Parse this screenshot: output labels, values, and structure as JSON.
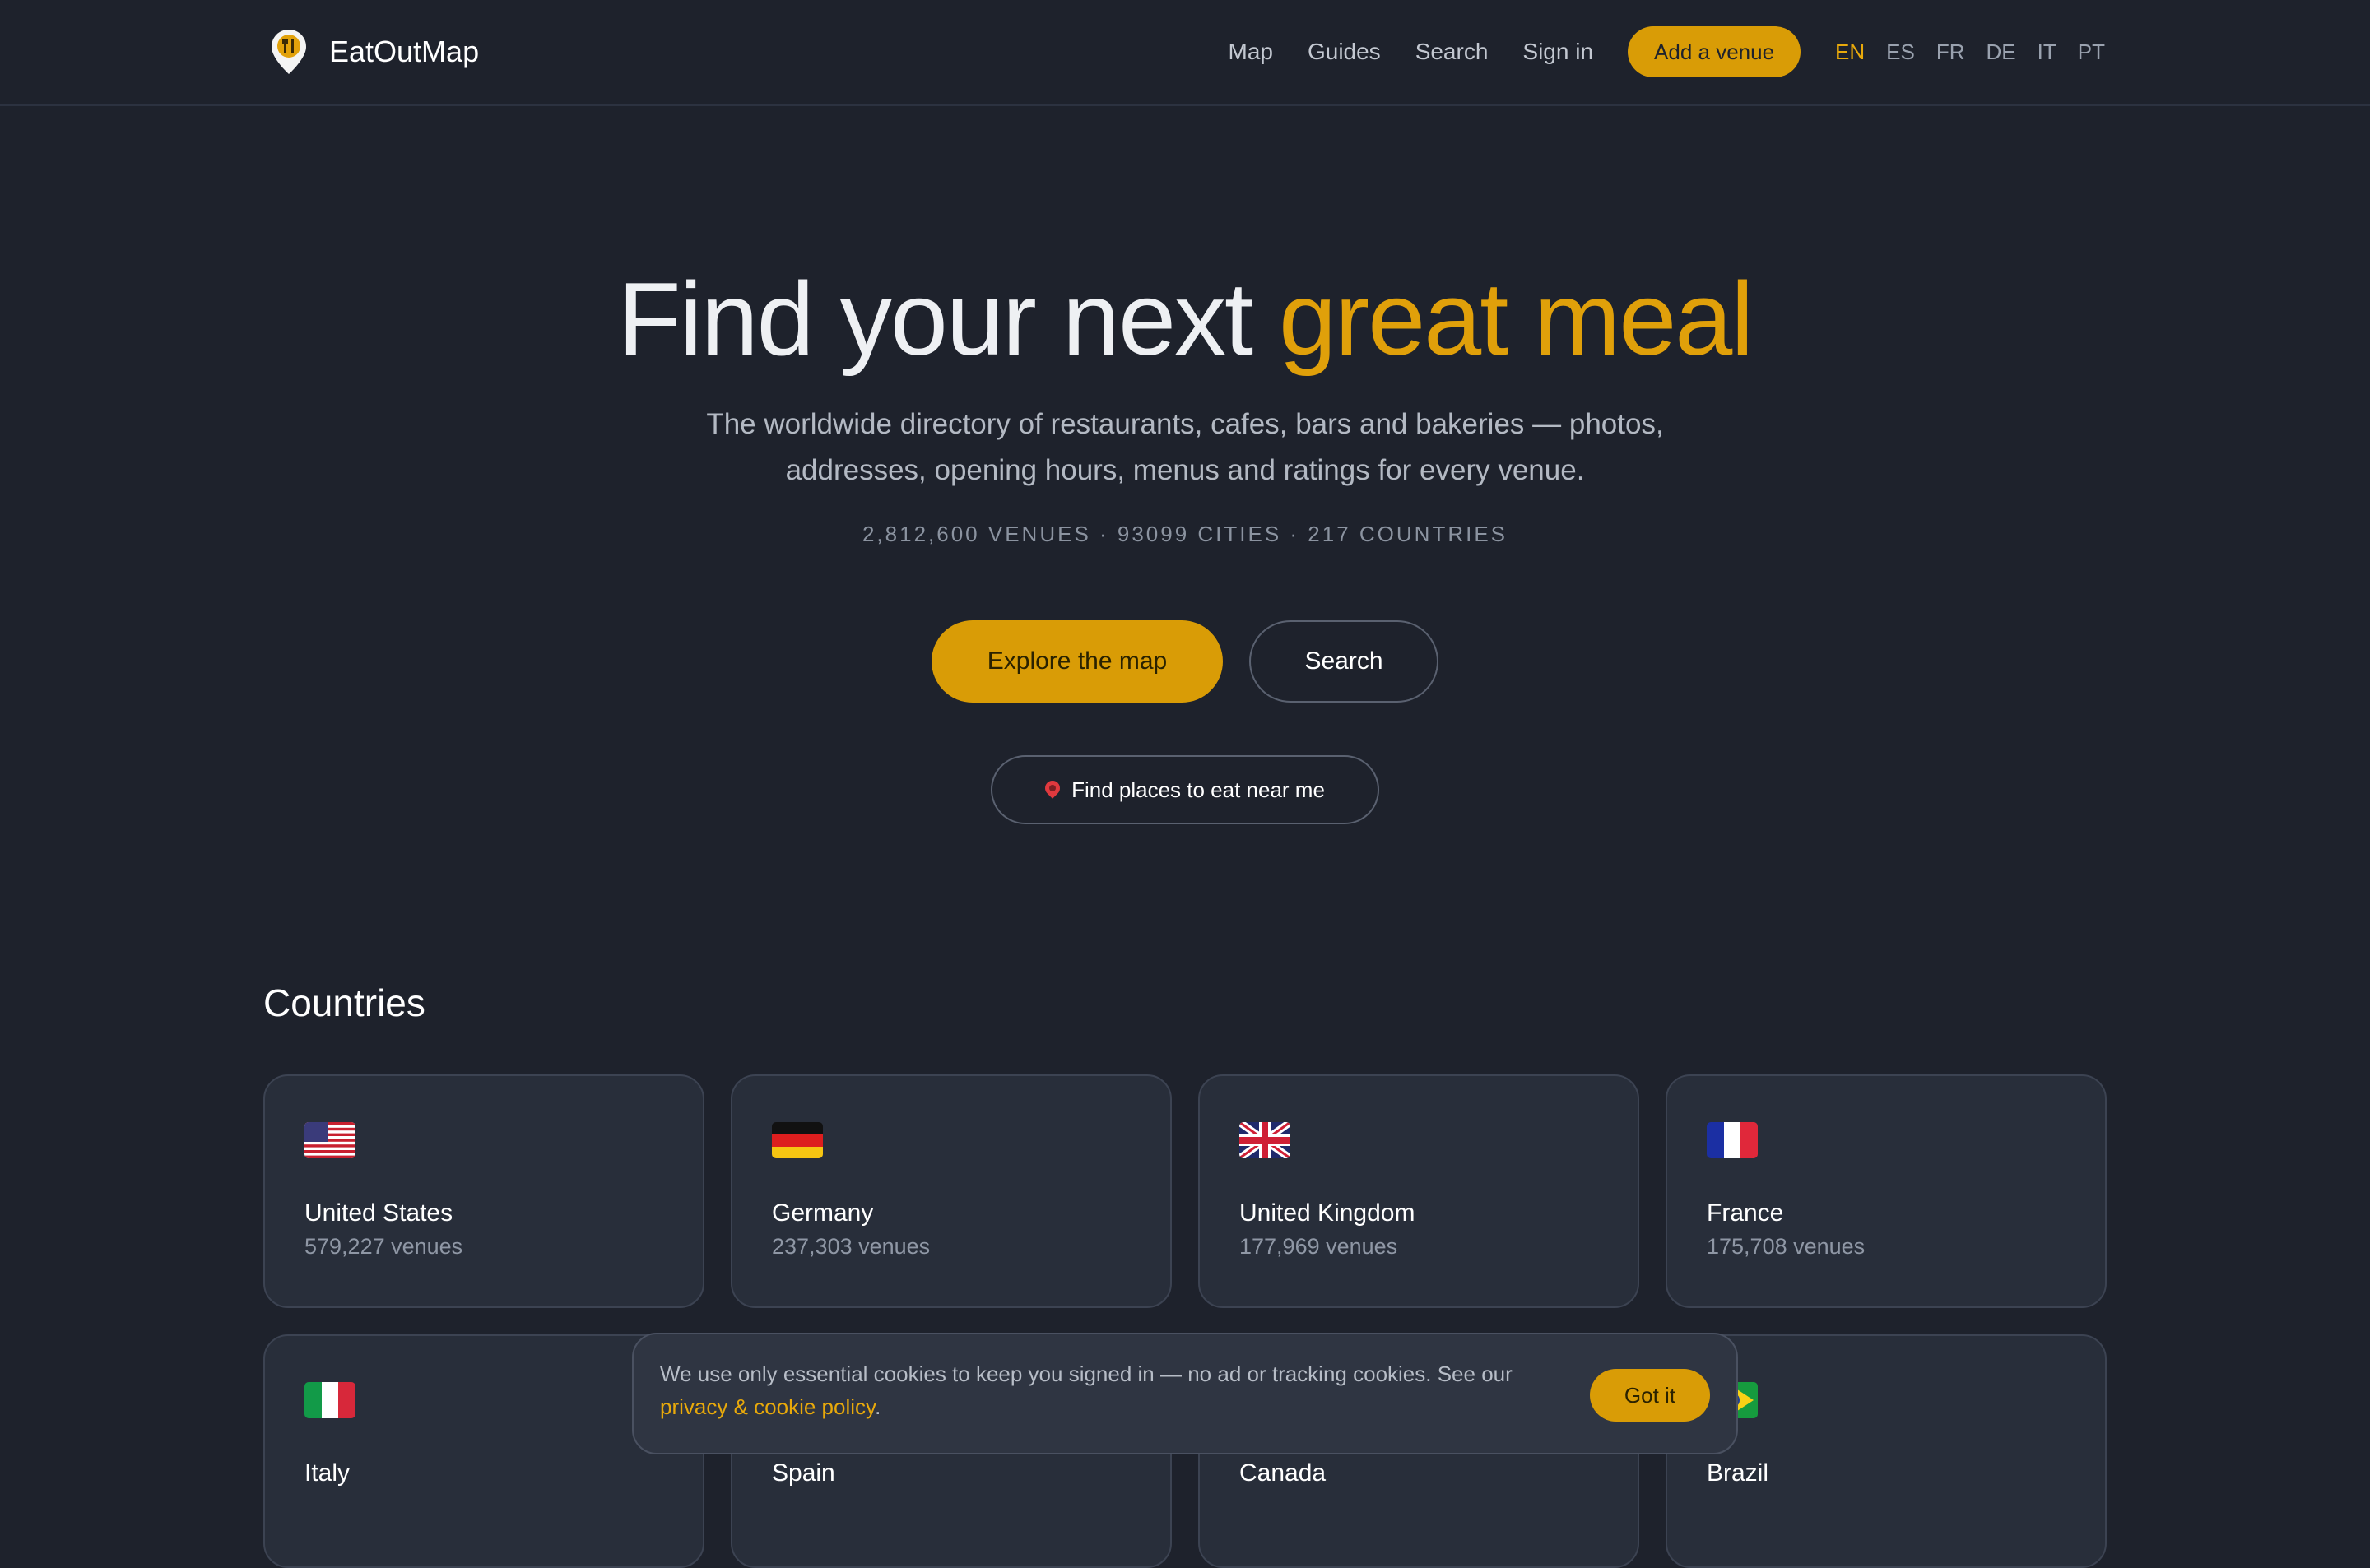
{
  "header": {
    "brand": "EatOutMap",
    "nav": [
      "Map",
      "Guides",
      "Search",
      "Sign in"
    ],
    "cta": "Add a venue",
    "languages": [
      "EN",
      "ES",
      "FR",
      "DE",
      "IT",
      "PT"
    ],
    "active_language": "EN"
  },
  "hero": {
    "title_main": "Find your next ",
    "title_accent": "great meal",
    "subtitle": "The worldwide directory of restaurants, cafes, bars and bakeries — photos, addresses, opening hours, menus and ratings for every venue.",
    "stats": "2,812,600 VENUES · 93099 CITIES · 217 COUNTRIES",
    "explore_button": "Explore the map",
    "search_button": "Search",
    "near_me_button": "Find places to eat near me"
  },
  "countries": {
    "title": "Countries",
    "items": [
      {
        "name": "United States",
        "count": "579,227 venues",
        "flag": "us-flag-icon"
      },
      {
        "name": "Germany",
        "count": "237,303 venues",
        "flag": "de-flag-icon"
      },
      {
        "name": "United Kingdom",
        "count": "177,969 venues",
        "flag": "gb-flag-icon"
      },
      {
        "name": "France",
        "count": "175,708 venues",
        "flag": "fr-flag-icon"
      },
      {
        "name": "Italy",
        "count": "",
        "flag": "it-flag-icon"
      },
      {
        "name": "Spain",
        "count": "",
        "flag": "es-flag-icon"
      },
      {
        "name": "Canada",
        "count": "",
        "flag": "ca-flag-icon"
      },
      {
        "name": "Brazil",
        "count": "",
        "flag": "br-flag-icon"
      }
    ]
  },
  "cookie": {
    "text": "We use only essential cookies to keep you signed in — no ad or tracking cookies. See our ",
    "link": "privacy & cookie policy",
    "suffix": ".",
    "button": "Got it"
  },
  "colors": {
    "background": "#1e222c",
    "accent": "#d99c06",
    "card": "#282e3a"
  }
}
